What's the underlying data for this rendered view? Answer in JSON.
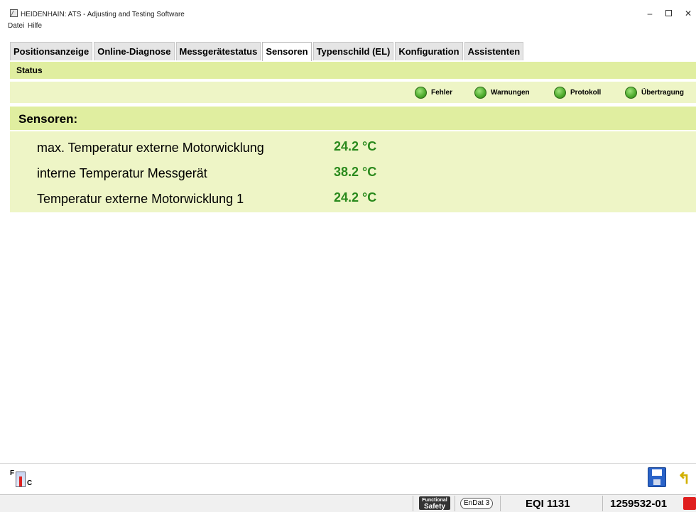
{
  "window": {
    "title": "HEIDENHAIN: ATS - Adjusting and Testing Software",
    "minimize_glyph": "–",
    "close_glyph": "✕"
  },
  "menu": [
    "Datei",
    "Hilfe"
  ],
  "tabs": [
    {
      "label": "Positionsanzeige",
      "active": false
    },
    {
      "label": "Online-Diagnose",
      "active": false
    },
    {
      "label": "Messgerätestatus",
      "active": false
    },
    {
      "label": "Sensoren",
      "active": true
    },
    {
      "label": "Typenschild (EL)",
      "active": false
    },
    {
      "label": "Konfiguration",
      "active": false
    },
    {
      "label": "Assistenten",
      "active": false
    }
  ],
  "status": {
    "label": "Status",
    "indicators": [
      {
        "label": "Fehler",
        "color": "#4caa2c"
      },
      {
        "label": "Warnungen",
        "color": "#4caa2c"
      },
      {
        "label": "Protokoll",
        "color": "#4caa2c"
      },
      {
        "label": "Übertragung",
        "color": "#4caa2c"
      }
    ]
  },
  "sensors": {
    "heading": "Sensoren:",
    "rows": [
      {
        "name": "max. Temperatur externe Motorwicklung",
        "value": "24.2 °C"
      },
      {
        "name": "interne Temperatur Messgerät",
        "value": "38.2 °C"
      },
      {
        "name": "Temperatur externe Motorwicklung 1",
        "value": "24.2 °C"
      }
    ]
  },
  "toolbar": {
    "fc_f": "F",
    "fc_c": "C",
    "back_glyph": "↰"
  },
  "footer": {
    "functional_label": "Functional",
    "safety_label": "Safety",
    "endat_label": "EnDat 3",
    "model": "EQI 1131",
    "id_number": "1259532-01"
  },
  "colors": {
    "panel_dark": "#e0eea0",
    "panel_light": "#eef5c6",
    "value_green": "#2a8a1d"
  }
}
